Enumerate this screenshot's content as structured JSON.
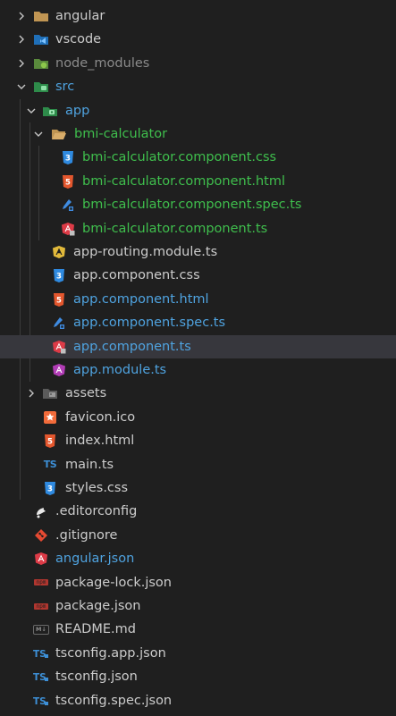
{
  "explorer": {
    "items": [
      {
        "label": "angular",
        "color": "#cccccc",
        "icon": "folder-icon",
        "expanded": false,
        "is_folder": true
      },
      {
        "label": "vscode",
        "color": "#cccccc",
        "icon": "vscode-folder-icon",
        "expanded": false,
        "is_folder": true
      },
      {
        "label": "node_modules",
        "color": "#8b8b8b",
        "icon": "node-folder-icon",
        "expanded": false,
        "is_folder": true
      },
      {
        "label": "src",
        "color": "#4fa3e0",
        "icon": "src-folder-icon",
        "expanded": true,
        "is_folder": true
      },
      {
        "label": "app",
        "color": "#4fa3e0",
        "icon": "app-folder-icon",
        "expanded": true,
        "is_folder": true
      },
      {
        "label": "bmi-calculator",
        "color": "#3fbf4d",
        "icon": "open-folder-icon",
        "expanded": true,
        "is_folder": true
      },
      {
        "label": "bmi-calculator.component.css",
        "color": "#3fbf4d",
        "icon": "css-file-icon"
      },
      {
        "label": "bmi-calculator.component.html",
        "color": "#3fbf4d",
        "icon": "html-file-icon"
      },
      {
        "label": "bmi-calculator.component.spec.ts",
        "color": "#3fbf4d",
        "icon": "spec-file-icon"
      },
      {
        "label": "bmi-calculator.component.ts",
        "color": "#3fbf4d",
        "icon": "angular-component-icon"
      },
      {
        "label": "app-routing.module.ts",
        "color": "#cccccc",
        "icon": "angular-routing-icon"
      },
      {
        "label": "app.component.css",
        "color": "#cccccc",
        "icon": "css-file-icon"
      },
      {
        "label": "app.component.html",
        "color": "#4fa3e0",
        "icon": "html-file-icon"
      },
      {
        "label": "app.component.spec.ts",
        "color": "#4fa3e0",
        "icon": "spec-file-icon"
      },
      {
        "label": "app.component.ts",
        "color": "#4fa3e0",
        "icon": "angular-component-icon",
        "selected": true
      },
      {
        "label": "app.module.ts",
        "color": "#4fa3e0",
        "icon": "angular-module-icon"
      },
      {
        "label": "assets",
        "color": "#cccccc",
        "icon": "assets-folder-icon",
        "expanded": false,
        "is_folder": true
      },
      {
        "label": "favicon.ico",
        "color": "#cccccc",
        "icon": "favicon-star-icon"
      },
      {
        "label": "index.html",
        "color": "#cccccc",
        "icon": "html-file-icon"
      },
      {
        "label": "main.ts",
        "color": "#cccccc",
        "icon": "typescript-icon"
      },
      {
        "label": "styles.css",
        "color": "#cccccc",
        "icon": "css-file-icon"
      },
      {
        "label": ".editorconfig",
        "color": "#cccccc",
        "icon": "editorconfig-icon"
      },
      {
        "label": ".gitignore",
        "color": "#cccccc",
        "icon": "git-icon"
      },
      {
        "label": "angular.json",
        "color": "#4fa3e0",
        "icon": "angular-icon"
      },
      {
        "label": "package-lock.json",
        "color": "#cccccc",
        "icon": "npm-icon"
      },
      {
        "label": "package.json",
        "color": "#cccccc",
        "icon": "npm-icon"
      },
      {
        "label": "README.md",
        "color": "#cccccc",
        "icon": "markdown-icon"
      },
      {
        "label": "tsconfig.app.json",
        "color": "#cccccc",
        "icon": "tsconfig-icon"
      },
      {
        "label": "tsconfig.json",
        "color": "#cccccc",
        "icon": "tsconfig-icon"
      },
      {
        "label": "tsconfig.spec.json",
        "color": "#cccccc",
        "icon": "tsconfig-icon"
      }
    ]
  },
  "icon_text": {
    "ts": "TS",
    "npm": "npm",
    "md": "M↓",
    "css": "3",
    "html": "5"
  }
}
